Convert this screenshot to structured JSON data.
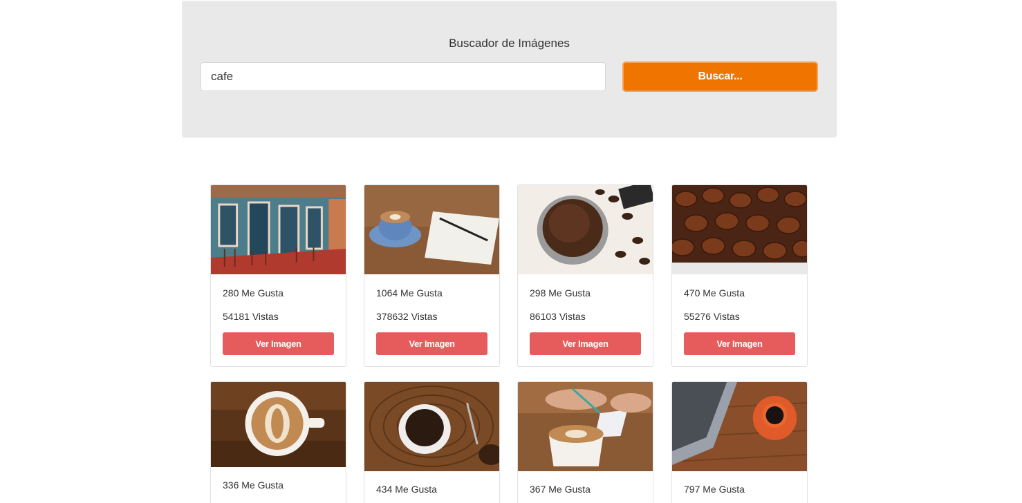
{
  "header": {
    "title": "Buscador de Imágenes",
    "search_value": "cafe",
    "search_button_label": "Buscar..."
  },
  "results": [
    {
      "likes": "280 Me Gusta",
      "views": "54181 Vistas",
      "button_label": "Ver Imagen",
      "image": "cafe-terrace-photo"
    },
    {
      "likes": "1064 Me Gusta",
      "views": "378632 Vistas",
      "button_label": "Ver Imagen",
      "image": "coffee-cup-notebook-photo"
    },
    {
      "likes": "298 Me Gusta",
      "views": "86103 Vistas",
      "button_label": "Ver Imagen",
      "image": "espresso-portafilter-photo"
    },
    {
      "likes": "470 Me Gusta",
      "views": "55276 Vistas",
      "button_label": "Ver Imagen",
      "image": "coffee-beans-photo"
    },
    {
      "likes": "336 Me Gusta",
      "image": "latte-art-photo"
    },
    {
      "likes": "434 Me Gusta",
      "image": "black-coffee-wood-photo"
    },
    {
      "likes": "367 Me Gusta",
      "image": "latte-writing-photo"
    },
    {
      "likes": "797 Me Gusta",
      "image": "coffee-laptop-photo"
    }
  ],
  "colors": {
    "accent": "#f07400",
    "card_button": "#e65c5c",
    "header_background": "#e9e9e9"
  }
}
